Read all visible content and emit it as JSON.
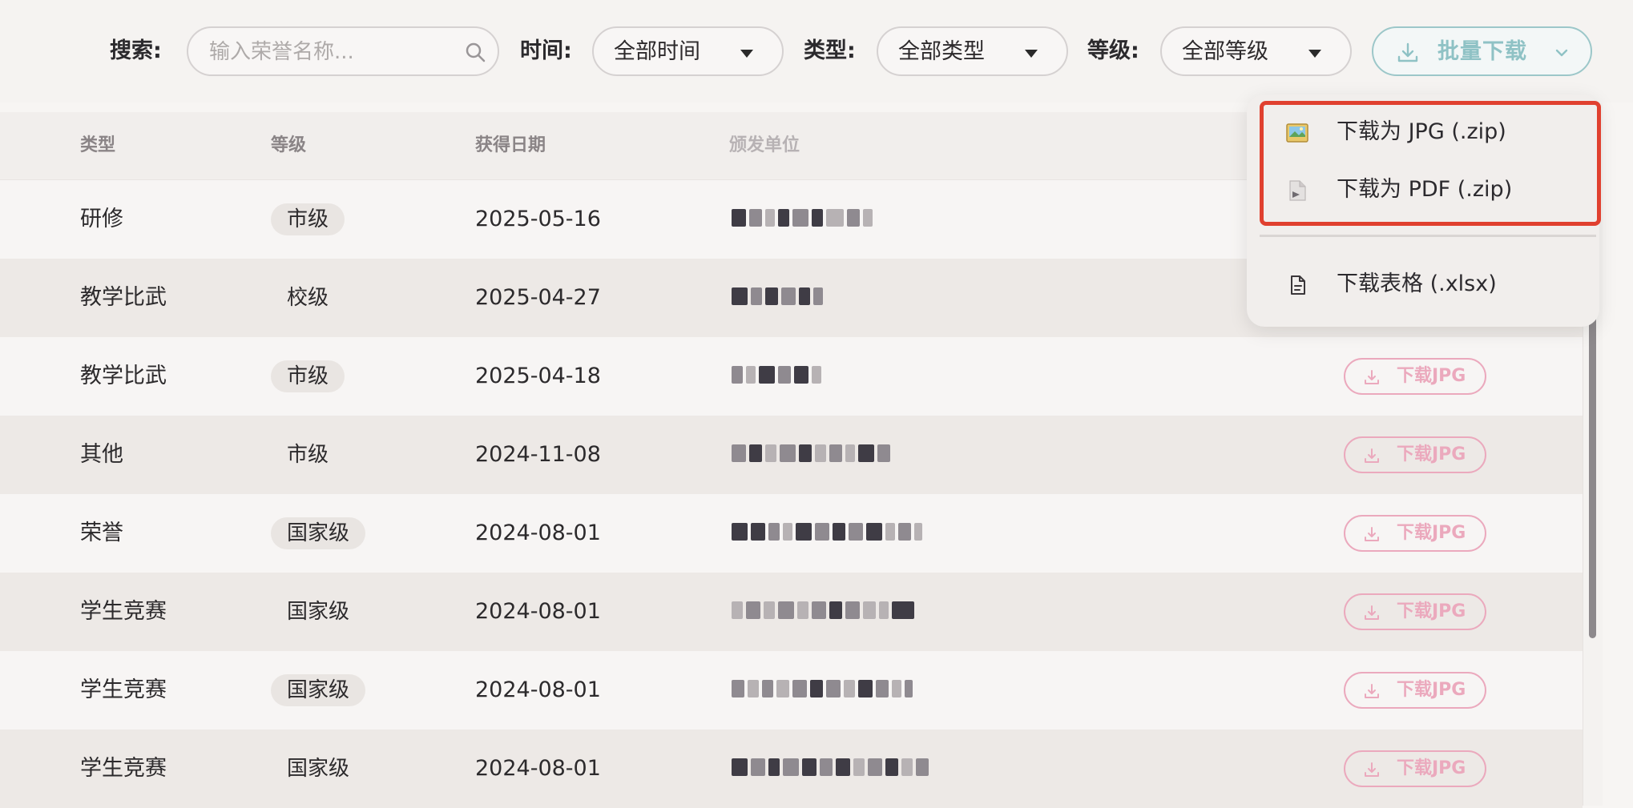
{
  "filters": {
    "search_label": "搜索:",
    "search_placeholder": "输入荣誉名称...",
    "time_label": "时间:",
    "time_value": "全部时间",
    "type_label": "类型:",
    "type_value": "全部类型",
    "level_label": "等级:",
    "level_value": "全部等级",
    "batch_download_label": "批量下载"
  },
  "colors": {
    "accent_teal": "#8fc2c5",
    "accent_pink": "#eba9bd",
    "highlight_red": "#e0402f"
  },
  "menu": {
    "items": [
      {
        "label": "下载为 JPG (.zip)",
        "icon": "image-icon"
      },
      {
        "label": "下载为 PDF (.zip)",
        "icon": "pdf-file-icon"
      },
      {
        "label": "下载表格 (.xlsx)",
        "icon": "document-icon"
      }
    ]
  },
  "table": {
    "columns": [
      "类型",
      "等级",
      "获得日期",
      "颁发单位"
    ],
    "download_label": "下载JPG",
    "rows": [
      {
        "type": "研修",
        "level": "市级",
        "date": "2025-05-16"
      },
      {
        "type": "教学比武",
        "level": "校级",
        "date": "2025-04-27"
      },
      {
        "type": "教学比武",
        "level": "市级",
        "date": "2025-04-18"
      },
      {
        "type": "其他",
        "level": "市级",
        "date": "2024-11-08"
      },
      {
        "type": "荣誉",
        "level": "国家级",
        "date": "2024-08-01"
      },
      {
        "type": "学生竞赛",
        "level": "国家级",
        "date": "2024-08-01"
      },
      {
        "type": "学生竞赛",
        "level": "国家级",
        "date": "2024-08-01"
      },
      {
        "type": "学生竞赛",
        "level": "国家级",
        "date": "2024-08-01"
      }
    ]
  }
}
